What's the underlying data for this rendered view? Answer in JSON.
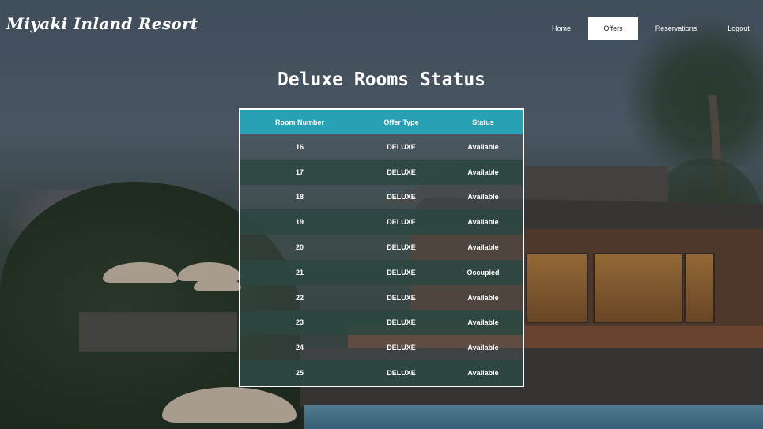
{
  "header": {
    "brand": "Miyaki Inland Resort",
    "nav": [
      {
        "label": "Home",
        "active": false
      },
      {
        "label": "Offers",
        "active": true
      },
      {
        "label": "Reservations",
        "active": false
      },
      {
        "label": "Logout",
        "active": false
      }
    ]
  },
  "main": {
    "title": "Deluxe Rooms Status",
    "table": {
      "columns": [
        "Room Number",
        "Offer Type",
        "Status"
      ],
      "rows": [
        [
          "16",
          "DELUXE",
          "Available"
        ],
        [
          "17",
          "DELUXE",
          "Available"
        ],
        [
          "18",
          "DELUXE",
          "Available"
        ],
        [
          "19",
          "DELUXE",
          "Available"
        ],
        [
          "20",
          "DELUXE",
          "Available"
        ],
        [
          "21",
          "DELUXE",
          "Occupied"
        ],
        [
          "22",
          "DELUXE",
          "Available"
        ],
        [
          "23",
          "DELUXE",
          "Available"
        ],
        [
          "24",
          "DELUXE",
          "Available"
        ],
        [
          "25",
          "DELUXE",
          "Available"
        ]
      ]
    }
  },
  "colors": {
    "header_row": "#28a1b4",
    "active_nav_bg": "#ffffff",
    "text": "#ffffff"
  }
}
